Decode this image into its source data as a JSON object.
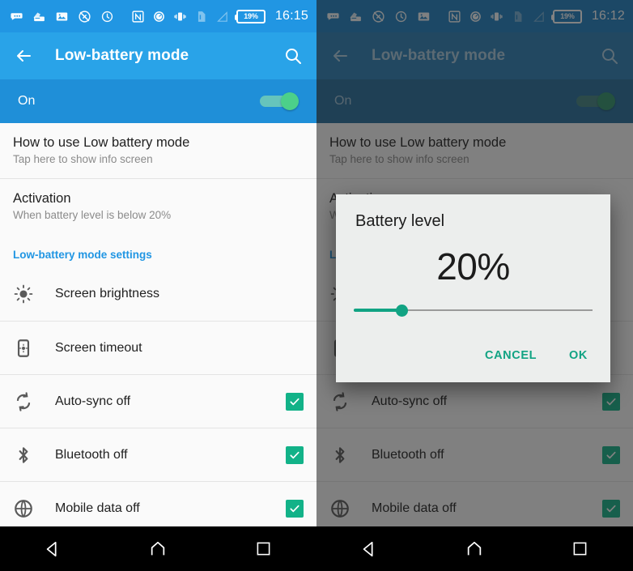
{
  "left": {
    "statusbar": {
      "left_icons": [
        "message-icon",
        "cards-icon",
        "photo-icon",
        "no-sim-icon",
        "clock-icon"
      ],
      "right_icons": [
        "nfc-icon",
        "data-saver-icon",
        "vibrate-icon",
        "sim-card-icon",
        "signal-icon"
      ],
      "battery": "19%",
      "time": "16:15"
    },
    "appbar": {
      "title": "Low-battery mode",
      "back": "back-arrow",
      "search": "search"
    },
    "master_switch": {
      "label": "On",
      "checked": true
    },
    "rows": [
      {
        "title": "How to use Low battery mode",
        "subtitle": "Tap here to show info screen"
      },
      {
        "title": "Activation",
        "subtitle": "When battery level is below 20%"
      }
    ],
    "section_header": "Low-battery mode settings",
    "items": [
      {
        "label": "Screen brightness",
        "icon": "brightness-icon",
        "checkbox": false
      },
      {
        "label": "Screen timeout",
        "icon": "screen-timeout-icon",
        "checkbox": false
      },
      {
        "label": "Auto-sync off",
        "icon": "sync-icon",
        "checkbox": true
      },
      {
        "label": "Bluetooth off",
        "icon": "bluetooth-icon",
        "checkbox": true
      },
      {
        "label": "Mobile data off",
        "icon": "globe-icon",
        "checkbox": true
      }
    ],
    "navbar": [
      "back-nav",
      "home-nav",
      "recents-nav"
    ]
  },
  "right": {
    "statusbar": {
      "left_icons": [
        "message-icon",
        "cards-icon",
        "no-sim-icon",
        "clock-icon",
        "photo-icon"
      ],
      "right_icons": [
        "nfc-icon",
        "data-saver-icon",
        "vibrate-icon",
        "sim-card-icon",
        "signal-icon"
      ],
      "battery": "19%",
      "time": "16:12"
    },
    "appbar": {
      "title": "Low-battery mode"
    },
    "master_switch": {
      "label": "On",
      "checked": true
    },
    "rows": [
      {
        "title": "How to use Low battery mode",
        "subtitle": "Tap here to show info screen"
      },
      {
        "title": "Activation",
        "subtitle": "When battery level is below 20%"
      }
    ],
    "section_header": "Low-battery mode settings",
    "items": [
      {
        "label": "Screen brightness",
        "icon": "brightness-icon",
        "checkbox": false
      },
      {
        "label": "Screen timeout",
        "icon": "screen-timeout-icon",
        "checkbox": false
      },
      {
        "label": "Auto-sync off",
        "icon": "sync-icon",
        "checkbox": true
      },
      {
        "label": "Bluetooth off",
        "icon": "bluetooth-icon",
        "checkbox": true
      },
      {
        "label": "Mobile data off",
        "icon": "globe-icon",
        "checkbox": true
      }
    ],
    "dialog": {
      "title": "Battery level",
      "value": "20%",
      "slider_percent": 20,
      "cancel": "CANCEL",
      "ok": "OK"
    },
    "navbar": [
      "back-nav",
      "home-nav",
      "recents-nav"
    ]
  },
  "colors": {
    "appbar_blue": "#29a3e8",
    "switchrow_blue": "#1f8fd8",
    "accent_teal": "#11a383",
    "checkbox_green": "#12b288",
    "section_blue": "#2196e3"
  }
}
